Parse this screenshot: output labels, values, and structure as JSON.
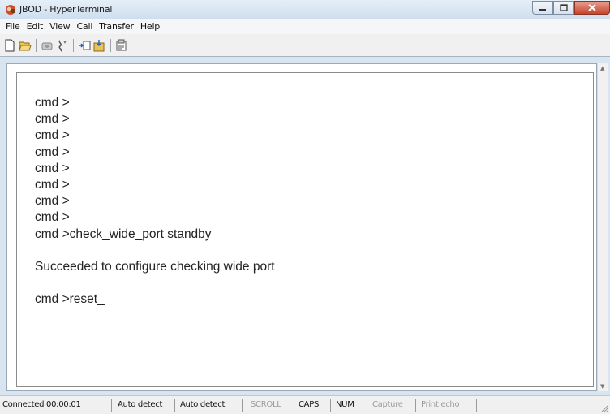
{
  "window": {
    "title": "JBOD - HyperTerminal",
    "app_icon": "hyperterminal-icon",
    "controls": [
      "minimize-icon",
      "maximize-icon",
      "close-icon"
    ],
    "colors": {
      "close_button": "#c8432c",
      "titlebar": "#dce8f4"
    }
  },
  "menubar": {
    "items": [
      {
        "label": "File"
      },
      {
        "label": "Edit"
      },
      {
        "label": "View"
      },
      {
        "label": "Call"
      },
      {
        "label": "Transfer"
      },
      {
        "label": "Help"
      }
    ]
  },
  "toolbar": {
    "buttons": [
      "new-icon",
      "open-icon",
      "connect-icon",
      "disconnect-icon",
      "send-icon",
      "receive-icon",
      "properties-icon"
    ]
  },
  "terminal": {
    "lines": [
      "cmd >",
      "cmd >",
      "cmd >",
      "cmd >",
      "cmd >",
      "cmd >",
      "cmd >",
      "cmd >",
      "cmd >check_wide_port standby",
      "",
      "Succeeded to configure checking wide port",
      "",
      "cmd >reset_"
    ]
  },
  "statusbar": {
    "connected": "Connected 00:00:01",
    "emulation": "Auto detect",
    "settings": "Auto detect",
    "scroll": "SCROLL",
    "caps": "CAPS",
    "num": "NUM",
    "capture": "Capture",
    "print_echo": "Print echo"
  }
}
